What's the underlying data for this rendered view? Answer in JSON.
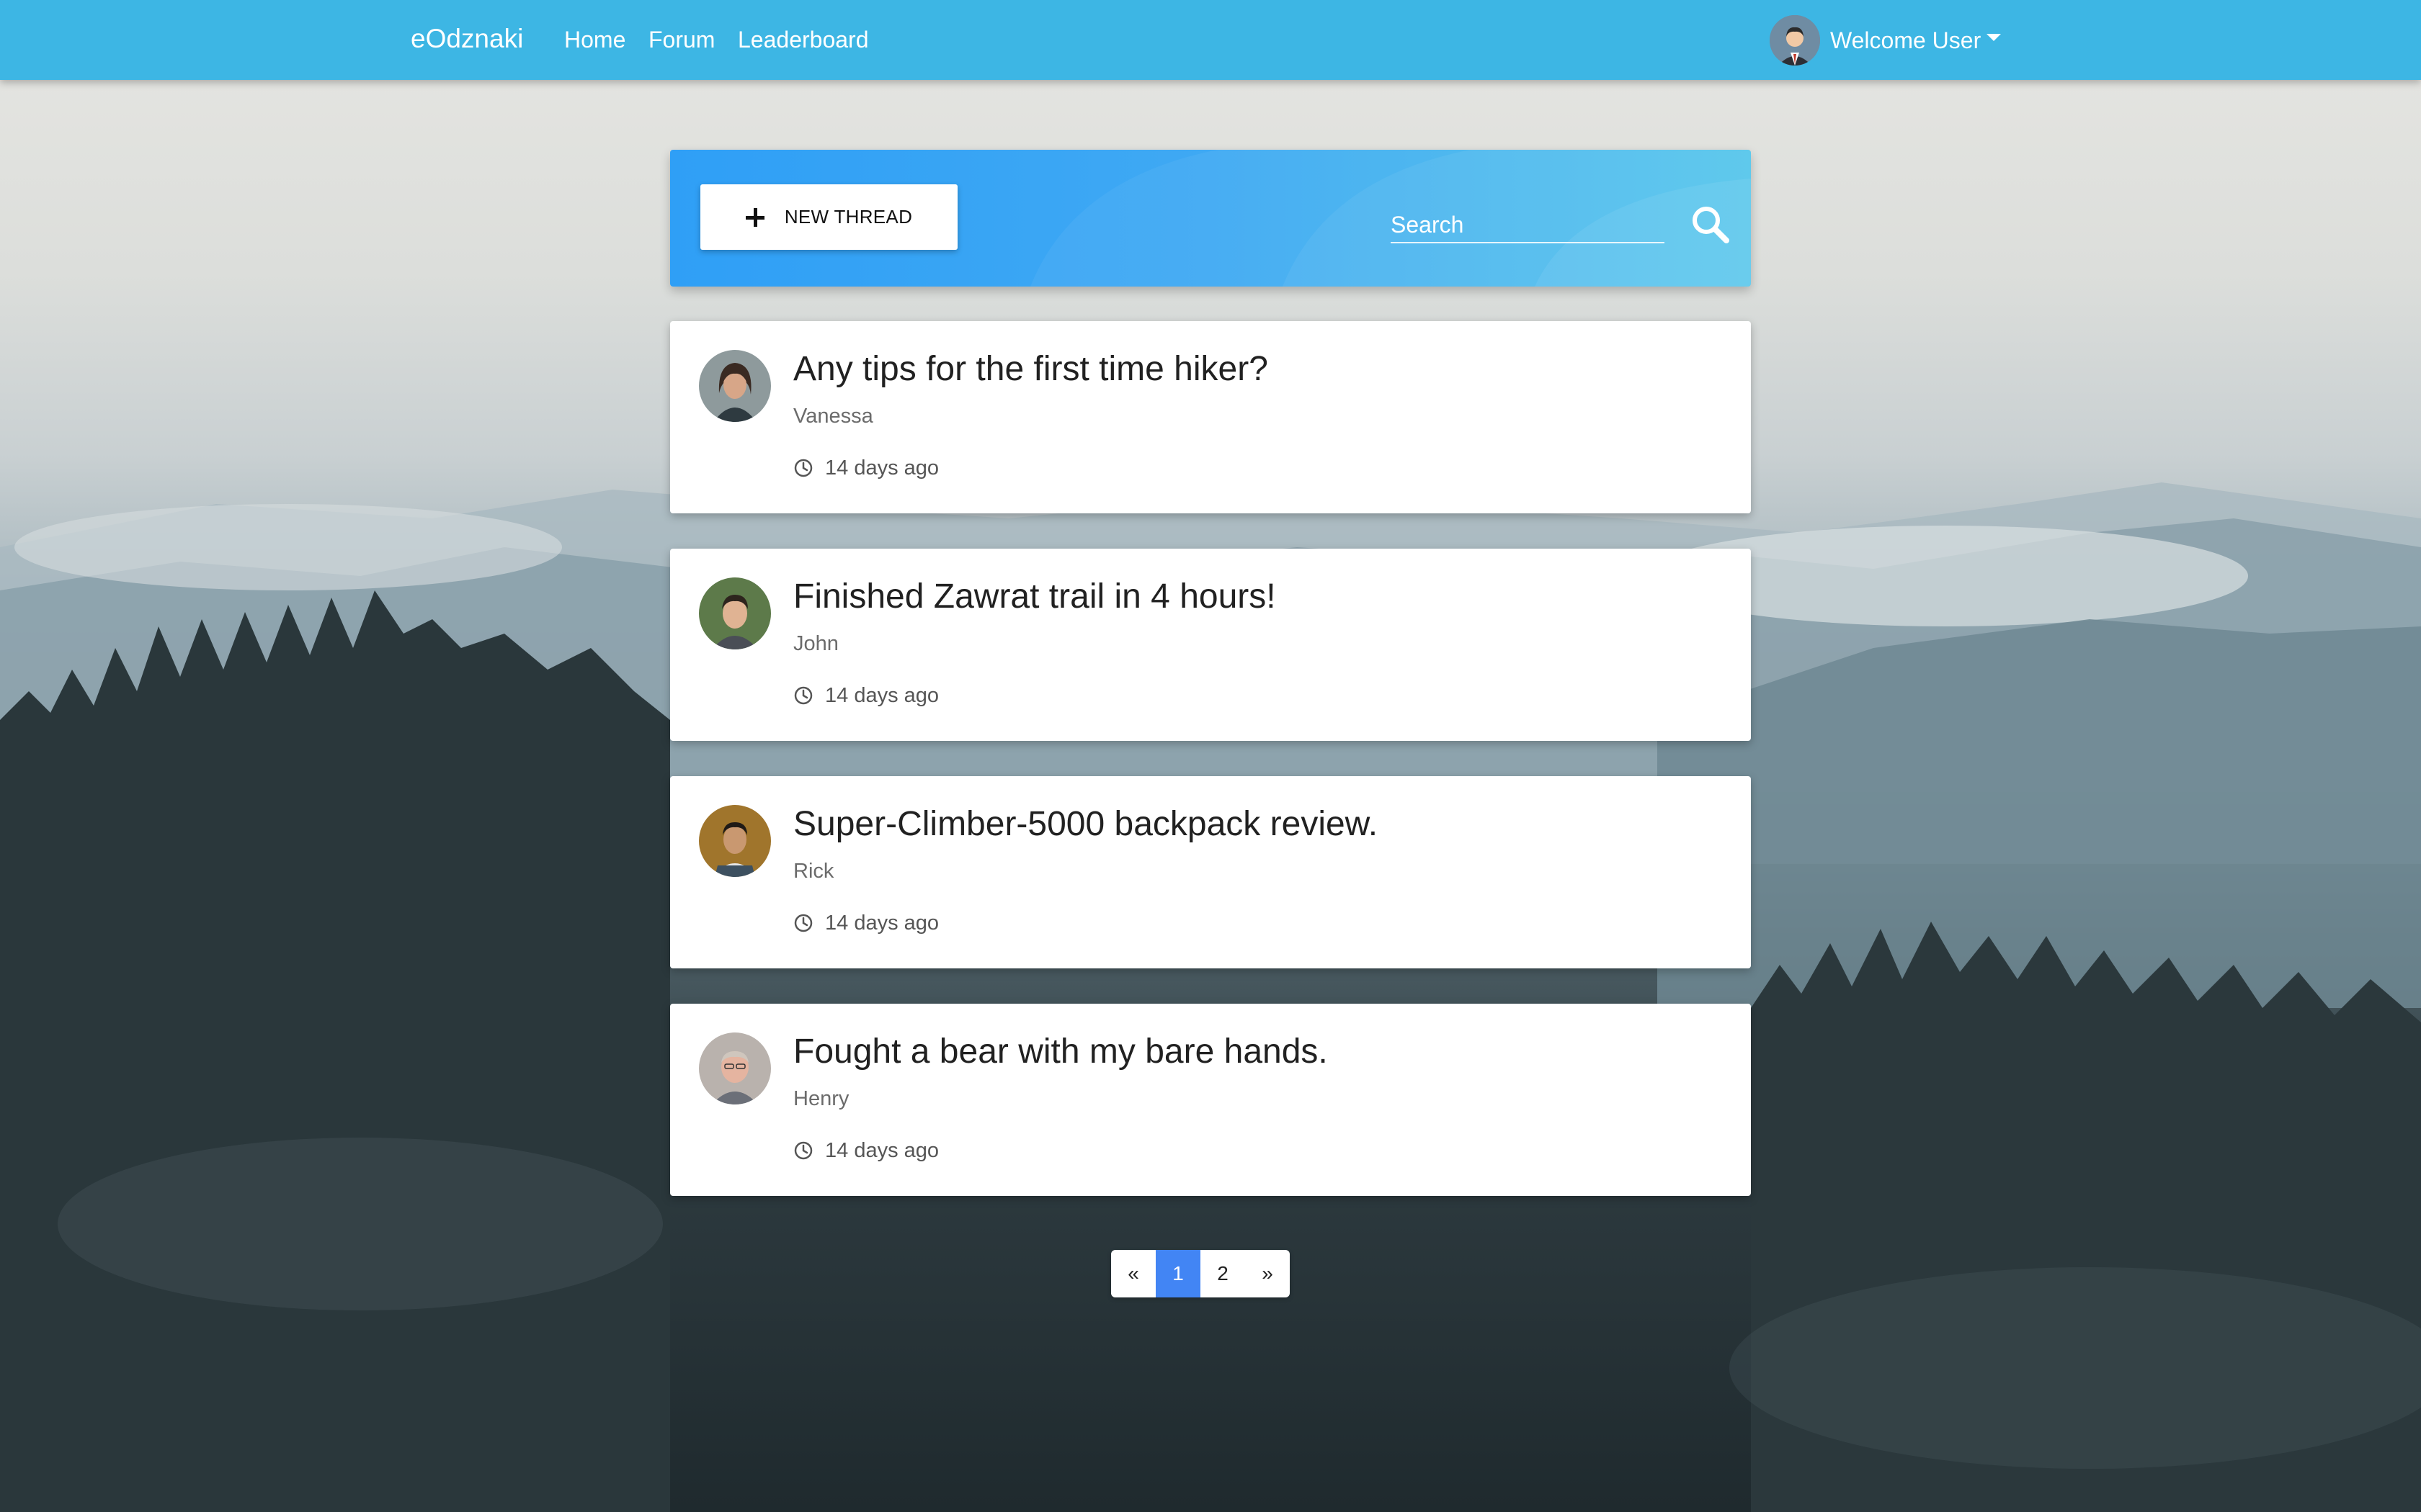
{
  "navbar": {
    "brand": "eOdznaki",
    "links": {
      "home": "Home",
      "forum": "Forum",
      "leaderboard": "Leaderboard"
    },
    "user_menu_label": "Welcome User",
    "color": "#3db6e4"
  },
  "toolbar": {
    "new_thread_label": "NEW THREAD",
    "search_placeholder": "Search"
  },
  "threads": [
    {
      "title": "Any tips for the first time hiker?",
      "author": "Vanessa",
      "time": "14 days ago"
    },
    {
      "title": "Finished Zawrat trail in 4 hours!",
      "author": "John",
      "time": "14 days ago"
    },
    {
      "title": "Super-Climber-5000 backpack review.",
      "author": "Rick",
      "time": "14 days ago"
    },
    {
      "title": "Fought a bear with my bare hands.",
      "author": "Henry",
      "time": "14 days ago"
    }
  ],
  "pagination": {
    "prev": "«",
    "pages": [
      "1",
      "2"
    ],
    "next": "»",
    "active_page": "1",
    "active_color": "#4285f4"
  },
  "icons": [
    "plus-icon",
    "search-icon",
    "clock-icon",
    "chevron-down-icon"
  ]
}
